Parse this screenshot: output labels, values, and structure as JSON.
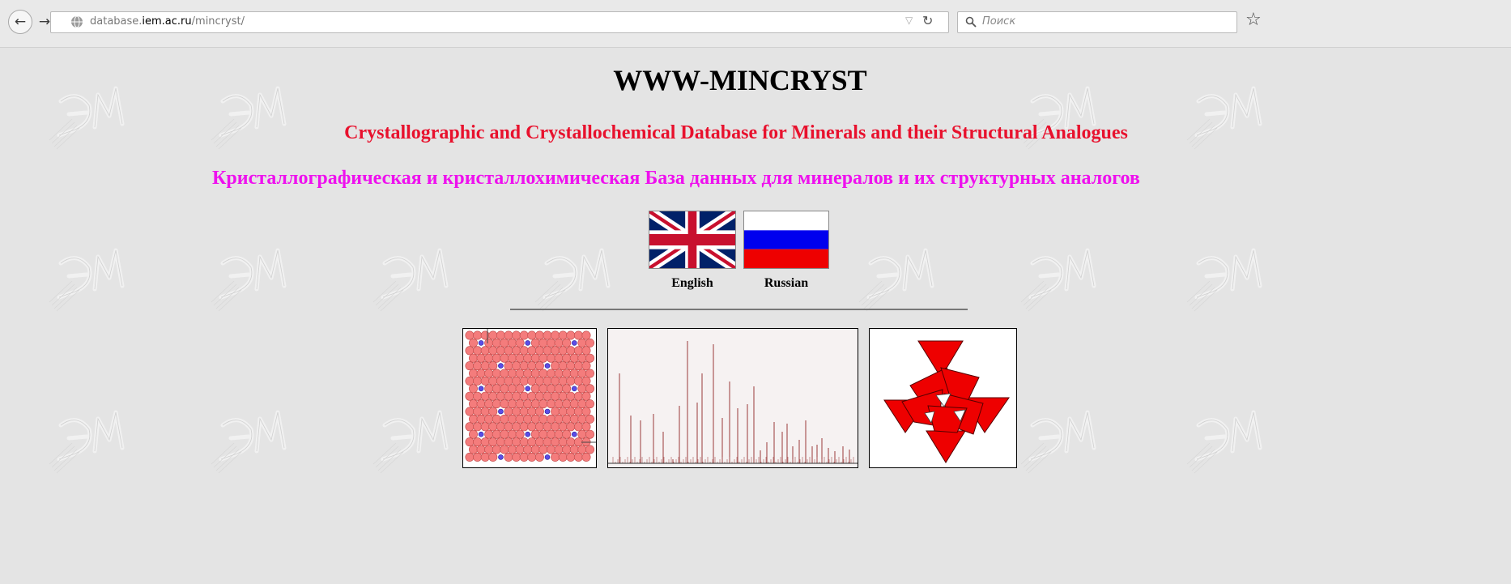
{
  "browser": {
    "url_prefix": "database.",
    "url_host": "iem.ac.ru",
    "url_path": "/mincryst/",
    "search_placeholder": "Поиск",
    "icons": [
      "back-arrow-icon",
      "forward-arrow-icon",
      "globe-icon",
      "dropdown-icon",
      "reload-icon",
      "search-icon",
      "bookmark-star-icon"
    ]
  },
  "page": {
    "title": "WWW-MINCRYST",
    "subtitle_en": "Crystallographic and Crystallochemical Database for Minerals and their Structural Analogues",
    "subtitle_ru": "Кристаллографическая и кристаллохимическая База данных для минералов и их структурных аналогов",
    "languages": [
      {
        "label": "English",
        "icon": "uk-flag-icon"
      },
      {
        "label": "Russian",
        "icon": "russia-flag-icon"
      }
    ],
    "images": [
      "crystal-structure-image",
      "diffraction-pattern-image",
      "polyhedra-image"
    ],
    "colors": {
      "subtitle_en": "#e8112d",
      "subtitle_ru": "#ee11ee",
      "background": "#e4e4e4"
    }
  }
}
